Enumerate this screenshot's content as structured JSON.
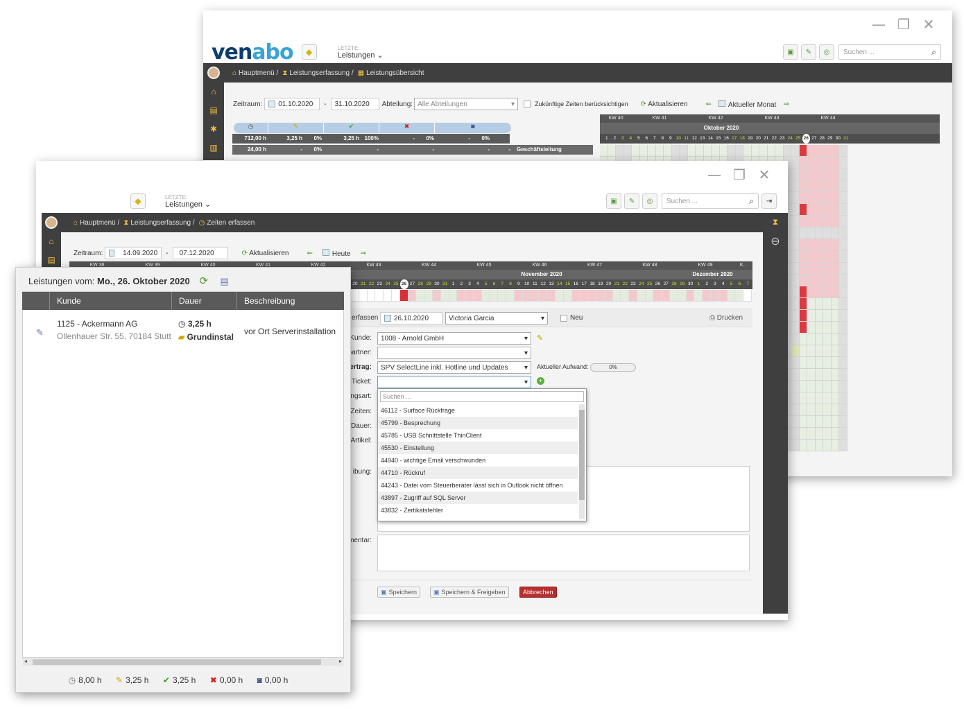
{
  "back_window": {
    "logo": {
      "a": "ven",
      "b": "abo"
    },
    "recent_label": "LETZTE:",
    "recent_value": "Leistungen",
    "search_placeholder": "Suchen ...",
    "breadcrumb": [
      "Hauptmenü",
      "Leistungserfassung",
      "Leistungsübersicht"
    ],
    "filter": {
      "zeitraum_label": "Zeitraum:",
      "from": "01.10.2020",
      "dash": "-",
      "to": "31.10.2020",
      "abteilung_label": "Abteilung:",
      "abteilung_value": "Alle Abteilungen",
      "future_label": "Zukünftige Zeiten berücksichtigen",
      "refresh": "Aktualisieren",
      "current_month": "Aktueller Monat"
    },
    "kw": [
      "KW 40",
      "KW 41",
      "KW 42",
      "KW 43",
      "KW 44"
    ],
    "month": "Oktober 2020",
    "days": [
      "1",
      "2",
      "3",
      "4",
      "5",
      "6",
      "7",
      "8",
      "9",
      "10",
      "11",
      "12",
      "13",
      "14",
      "15",
      "16",
      "17",
      "18",
      "19",
      "20",
      "21",
      "22",
      "23",
      "24",
      "25",
      "26",
      "27",
      "28",
      "29",
      "30",
      "31"
    ],
    "sum_row": [
      "712,00 h",
      "3,25 h",
      "0%",
      "3,25 h",
      "100%",
      "-",
      "0%",
      "-",
      "0%"
    ],
    "dept_row": [
      "24,00 h",
      "-",
      "0%",
      "-",
      "-",
      "-",
      "-"
    ],
    "dept_name": "Geschäftsleitung"
  },
  "mid_window": {
    "recent_label": "LETZTE:",
    "recent_value": "Leistungen",
    "search_placeholder": "Suchen ...",
    "breadcrumb": [
      "Hauptmenü",
      "Leistungserfassung",
      "Zeiten erfassen"
    ],
    "filter": {
      "zeitraum_label": "Zeitraum:",
      "from": "14.09.2020",
      "dash": "-",
      "to": "07.12.2020",
      "refresh": "Aktualisieren",
      "today": "Heute"
    },
    "kw": [
      "KW 38",
      "KW 39",
      "KW 40",
      "KW 41",
      "KW 42",
      "KW 43",
      "KW 44",
      "KW 45",
      "KW 46",
      "KW 47",
      "KW 48",
      "KW 49",
      "K.."
    ],
    "month_nov": "November 2020",
    "month_dec": "Dezember 2020",
    "days_visible": [
      "20",
      "21",
      "22",
      "23",
      "24",
      "25",
      "26",
      "27",
      "28",
      "29",
      "30",
      "31",
      "1",
      "2",
      "3",
      "4",
      "5",
      "6",
      "7",
      "8",
      "9",
      "10",
      "11",
      "12",
      "13",
      "14",
      "15",
      "16",
      "17",
      "18",
      "19",
      "20",
      "21",
      "22",
      "23",
      "24",
      "25",
      "26",
      "27",
      "28",
      "29",
      "30",
      "1",
      "2",
      "3",
      "4",
      "5",
      "6",
      "7"
    ],
    "form": {
      "erfassen_label": "erfassen",
      "date": "26.10.2020",
      "employee": "Victoria Garcia",
      "neu_label": "Neu",
      "print": "Drucken",
      "kunde_label": "Kunde:",
      "kunde_value": "1008 - Arnold GmbH",
      "partner_label": "partner:",
      "vertrag_label": "ertrag:",
      "vertrag_value": "SPV SelectLine inkl. Hotline und Updates",
      "aufwand_label": "Aktueller Aufwand:",
      "aufwand_value": "0%",
      "ticket_label": "Ticket:",
      "art_label": "ngsart:",
      "zeiten_label": "Zeiten:",
      "dauer_label": "Dauer:",
      "artikel_label": "Artikel:",
      "beschreibung_label": "ibung:",
      "kommentar_label": "mentar:",
      "save": "Speichern",
      "save_release": "Speichern & Freigeben",
      "cancel": "Abbrechen"
    },
    "ticket_dropdown": {
      "search_placeholder": "Suchen ...",
      "items": [
        "46112 - Surface Rückfrage",
        "45799 - Besprechung",
        "45785 - USB Schnittstelle ThinClient",
        "45530 - Einstellung",
        "44940 - wichtige Email verschwunden",
        "44710 - Rückruf",
        "44243 - Datei vom Steuerberater lässt sich in Outlook nicht öffnen",
        "43897 - Zugriff auf SQL Server",
        "43832 - Zertikatsfehler"
      ]
    }
  },
  "mobile_panel": {
    "title_prefix": "Leistungen vom:",
    "title_date": "Mo., 26. Oktober 2020",
    "columns": [
      "Kunde",
      "Dauer",
      "Beschreibung"
    ],
    "row": {
      "kunde": "1125 - Ackermann AG",
      "address": "Ollenhauer Str. 55, 70184 Stutt",
      "dauer": "3,25 h",
      "art": "Grundinstal",
      "beschreibung": "vor Ort Serverinstallation"
    },
    "footer": [
      "8,00 h",
      "3,25 h",
      "3,25 h",
      "0,00 h",
      "0,00 h"
    ]
  },
  "colors": {
    "accent": "#3aa3d6",
    "navbar": "#3f3f3f",
    "danger": "#b82f2f"
  }
}
